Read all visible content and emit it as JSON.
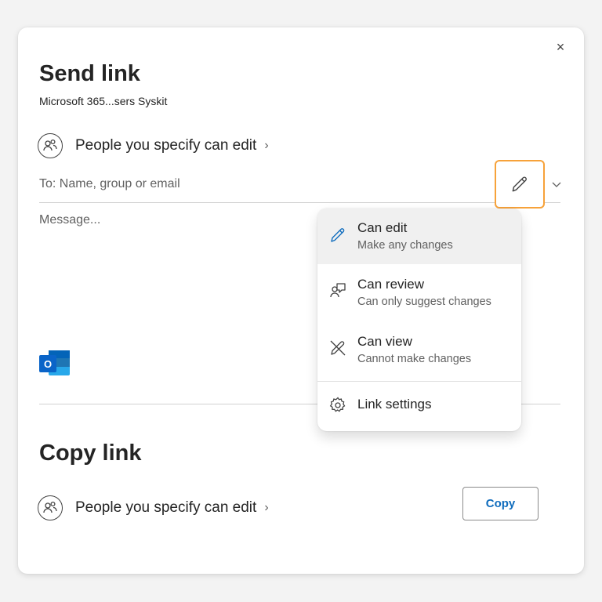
{
  "dialog": {
    "close_glyph": "×",
    "send": {
      "title": "Send link",
      "subtitle": "Microsoft 365...sers Syskit",
      "permission_label": "People you specify can edit",
      "chevron": "›",
      "to_placeholder": "To: Name, group or email",
      "message_placeholder": "Message..."
    },
    "copy": {
      "title": "Copy link",
      "permission_label": "People you specify can edit",
      "chevron": "›",
      "copy_button": "Copy"
    }
  },
  "permission_menu": {
    "items": [
      {
        "title": "Can edit",
        "desc": "Make any changes",
        "icon": "pencil-icon",
        "selected": true
      },
      {
        "title": "Can review",
        "desc": "Can only suggest changes",
        "icon": "review-icon",
        "selected": false
      },
      {
        "title": "Can view",
        "desc": "Cannot make changes",
        "icon": "no-edit-icon",
        "selected": false
      }
    ],
    "settings_label": "Link settings"
  },
  "colors": {
    "accent": "#0f6cbd",
    "highlight_outline": "#f7a23a",
    "outlook_blue": "#0a64c8"
  }
}
